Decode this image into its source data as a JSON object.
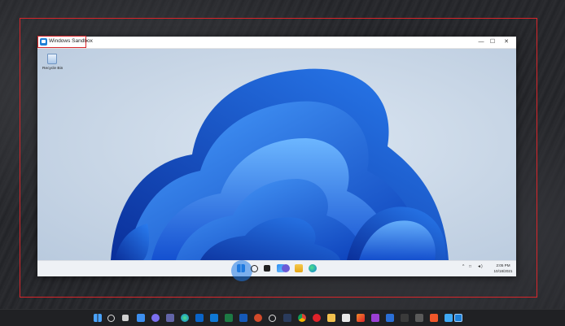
{
  "window": {
    "title": "Windows Sandbox",
    "controls": {
      "minimize": "—",
      "maximize": "☐",
      "close": "✕"
    }
  },
  "guest_desktop": {
    "recycle_bin_label": "Recycle Bin"
  },
  "guest_taskbar": {
    "icons": [
      "start-icon",
      "search-icon",
      "task-view-icon",
      "widgets-icon",
      "chat-icon",
      "file-explorer-icon",
      "edge-icon"
    ],
    "tray": {
      "chevron": "^",
      "network": "□",
      "volume": "◄)"
    },
    "clock": {
      "time": "2:05 PM",
      "date": "10/18/2021"
    }
  },
  "host_taskbar": {
    "icons": [
      "start-icon",
      "search-icon",
      "task-view-icon",
      "widgets-icon",
      "chat-icon",
      "teams-icon",
      "edge-icon",
      "mail-icon",
      "outlook-icon",
      "excel-icon",
      "powerpoint-icon",
      "onenote-icon",
      "snipping-icon",
      "chrome-icon",
      "opera-icon",
      "file-explorer-icon",
      "notepad-icon",
      "paint-icon",
      "app-icon",
      "terminal-icon",
      "brave-icon",
      "store-icon",
      "sandbox-icon"
    ]
  },
  "colors": {
    "highlight_red": "#d8262b",
    "bloom_blue": "#1e6ae0",
    "windows_blue": "#1d7fd6"
  }
}
